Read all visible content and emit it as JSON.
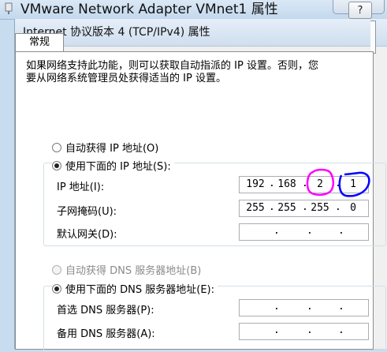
{
  "outer_window": {
    "title": "VMware Network Adapter VMnet1 属性"
  },
  "dialog": {
    "title": "Internet 协议版本 4 (TCP/IPv4) 属性",
    "help_label": "?",
    "tab_general": "常规",
    "description_line1": "如果网络支持此功能，则可以获取自动指派的 IP 设置。否则，您",
    "description_line2": "要从网络系统管理员处获得适当的 IP 设置。",
    "ip_section": {
      "auto_label": "自动获得 IP 地址(O)",
      "manual_label": "使用下面的 IP 地址(S):",
      "selected": "manual",
      "ip_label": "IP 地址(I):",
      "ip_octets": [
        "192",
        "168",
        "2",
        "1"
      ],
      "mask_label": "子网掩码(U):",
      "mask_octets": [
        "255",
        "255",
        "255",
        "0"
      ],
      "gateway_label": "默认网关(D):",
      "gateway_octets": [
        "",
        "",
        "",
        ""
      ]
    },
    "dns_section": {
      "auto_label": "自动获得 DNS 服务器地址(B)",
      "manual_label": "使用下面的 DNS 服务器地址(E):",
      "selected": "manual",
      "auto_disabled": true,
      "preferred_label": "首选 DNS 服务器(P):",
      "preferred_octets": [
        "",
        "",
        "",
        ""
      ],
      "alternate_label": "备用 DNS 服务器(A):",
      "alternate_octets": [
        "",
        "",
        "",
        ""
      ]
    },
    "annotations": {
      "circle_octet3_color": "#ff00ff",
      "circle_octet4_color": "#0000ff"
    }
  }
}
